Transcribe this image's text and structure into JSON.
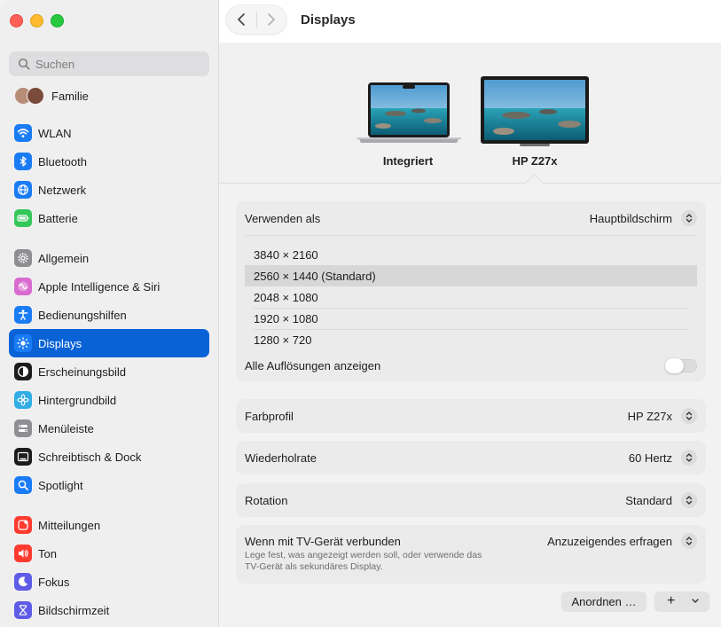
{
  "window": {
    "title": "Displays"
  },
  "sidebar": {
    "search_placeholder": "Suchen",
    "family_label": "Familie",
    "items": [
      {
        "label": "WLAN",
        "icon": "wifi-icon",
        "color": "#1a7cf5"
      },
      {
        "label": "Bluetooth",
        "icon": "bluetooth-icon",
        "color": "#1a7cf5"
      },
      {
        "label": "Netzwerk",
        "icon": "globe-icon",
        "color": "#1a7cf5"
      },
      {
        "label": "Batterie",
        "icon": "battery-icon",
        "color": "#34c759"
      },
      {
        "label": "Allgemein",
        "icon": "gear-icon",
        "color": "#8e8e93"
      },
      {
        "label": "Apple Intelligence & Siri",
        "icon": "siri-icon",
        "color": "#d96bd0"
      },
      {
        "label": "Bedienungshilfen",
        "icon": "accessibility-icon",
        "color": "#1a7cf5"
      },
      {
        "label": "Displays",
        "icon": "sun-icon",
        "color": "#1a7cf5"
      },
      {
        "label": "Erscheinungsbild",
        "icon": "appearance-icon",
        "color": "#1c1c1e"
      },
      {
        "label": "Hintergrundbild",
        "icon": "flower-icon",
        "color": "#32ade6"
      },
      {
        "label": "Menüleiste",
        "icon": "menubar-icon",
        "color": "#8e8e93"
      },
      {
        "label": "Schreibtisch & Dock",
        "icon": "dock-icon",
        "color": "#1c1c1e"
      },
      {
        "label": "Spotlight",
        "icon": "spotlight-icon",
        "color": "#1a7cf5"
      },
      {
        "label": "Mitteilungen",
        "icon": "bell-icon",
        "color": "#ff3b30"
      },
      {
        "label": "Ton",
        "icon": "speaker-icon",
        "color": "#ff3b30"
      },
      {
        "label": "Fokus",
        "icon": "moon-icon",
        "color": "#5e5ce6"
      },
      {
        "label": "Bildschirmzeit",
        "icon": "hourglass-icon",
        "color": "#5e5ce6"
      }
    ]
  },
  "displays": {
    "builtin_label": "Integriert",
    "external_label": "HP Z27x"
  },
  "settings": {
    "use_as": {
      "label": "Verwenden als",
      "value": "Hauptbildschirm"
    },
    "resolutions": [
      "3840 × 2160",
      "2560 × 1440 (Standard)",
      "2048 × 1080",
      "1920 × 1080",
      "1280 × 720"
    ],
    "selected_resolution": "2560 × 1440 (Standard)",
    "show_all": {
      "label": "Alle Auflösungen anzeigen",
      "on": false
    },
    "color_profile": {
      "label": "Farbprofil",
      "value": "HP Z27x"
    },
    "refresh_rate": {
      "label": "Wiederholrate",
      "value": "60 Hertz"
    },
    "rotation": {
      "label": "Rotation",
      "value": "Standard"
    },
    "tv": {
      "label": "Wenn mit TV-Gerät verbunden",
      "value": "Anzuzeigendes erfragen",
      "description_line1": "Lege fest, was angezeigt werden soll, oder verwende das",
      "description_line2": "TV-Gerät als sekundäres Display."
    }
  },
  "footer": {
    "arrange_label": "Anordnen …",
    "add_label": "+"
  },
  "colors": {
    "accent": "#0a63d6",
    "sidebar_bg": "#f0eff0",
    "card_bg": "#ebebeb"
  }
}
